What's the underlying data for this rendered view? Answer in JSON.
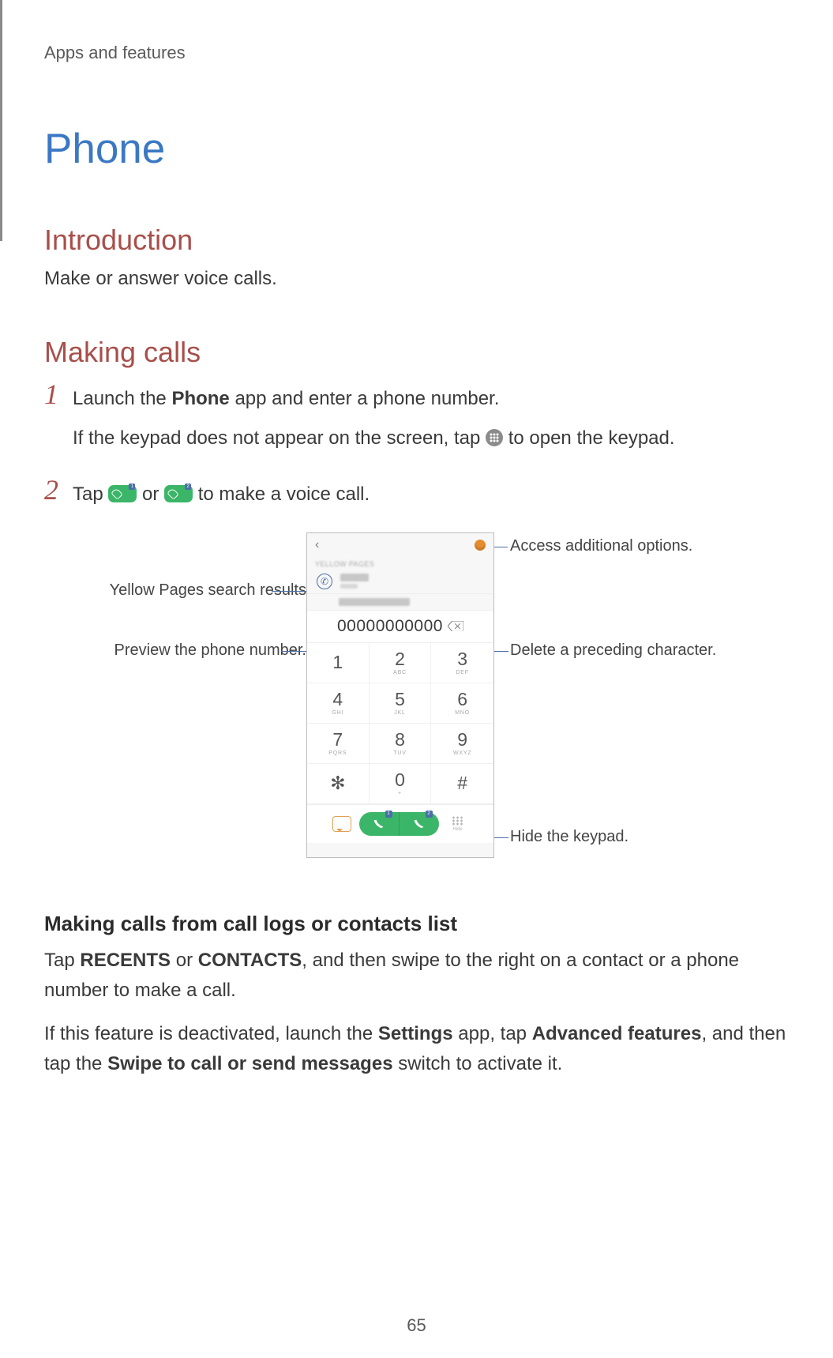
{
  "header": "Apps and features",
  "title": "Phone",
  "section1": {
    "heading": "Introduction",
    "text": "Make or answer voice calls."
  },
  "section2": {
    "heading": "Making calls",
    "step1_num": "1",
    "step1a_pre": "Launch the ",
    "step1a_bold": "Phone",
    "step1a_post": " app and enter a phone number.",
    "step1b_pre": "If the keypad does not appear on the screen, tap ",
    "step1b_post": " to open the keypad.",
    "step2_num": "2",
    "step2_pre": "Tap ",
    "step2_mid": " or ",
    "step2_post": " to make a voice call."
  },
  "callouts": {
    "yellow": "Yellow Pages search results",
    "preview": "Preview the phone number.",
    "options": "Access additional options.",
    "delete": "Delete a preceding character.",
    "hide": "Hide the keypad."
  },
  "screenshot": {
    "back": "‹",
    "yellow_label": "YELLOW PAGES",
    "number": "00000000000",
    "keys": [
      {
        "d": "1",
        "l": ""
      },
      {
        "d": "2",
        "l": "ABC"
      },
      {
        "d": "3",
        "l": "DEF"
      },
      {
        "d": "4",
        "l": "GHI"
      },
      {
        "d": "5",
        "l": "JKL"
      },
      {
        "d": "6",
        "l": "MNO"
      },
      {
        "d": "7",
        "l": "PQRS"
      },
      {
        "d": "8",
        "l": "TUV"
      },
      {
        "d": "9",
        "l": "WXYZ"
      },
      {
        "d": "✻",
        "l": ""
      },
      {
        "d": "0",
        "l": "+"
      },
      {
        "d": "#",
        "l": ""
      }
    ],
    "hide_label": "Hide",
    "sim1": "1",
    "sim2": "2"
  },
  "section3": {
    "heading": "Making calls from call logs or contacts list",
    "p1_pre": "Tap ",
    "p1_b1": "RECENTS",
    "p1_mid1": " or ",
    "p1_b2": "CONTACTS",
    "p1_post": ", and then swipe to the right on a contact or a phone number to make a call.",
    "p2_pre": "If this feature is deactivated, launch the ",
    "p2_b1": "Settings",
    "p2_mid1": " app, tap ",
    "p2_b2": "Advanced features",
    "p2_mid2": ", and then tap the ",
    "p2_b3": "Swipe to call or send messages",
    "p2_post": " switch to activate it."
  },
  "page_number": "65"
}
